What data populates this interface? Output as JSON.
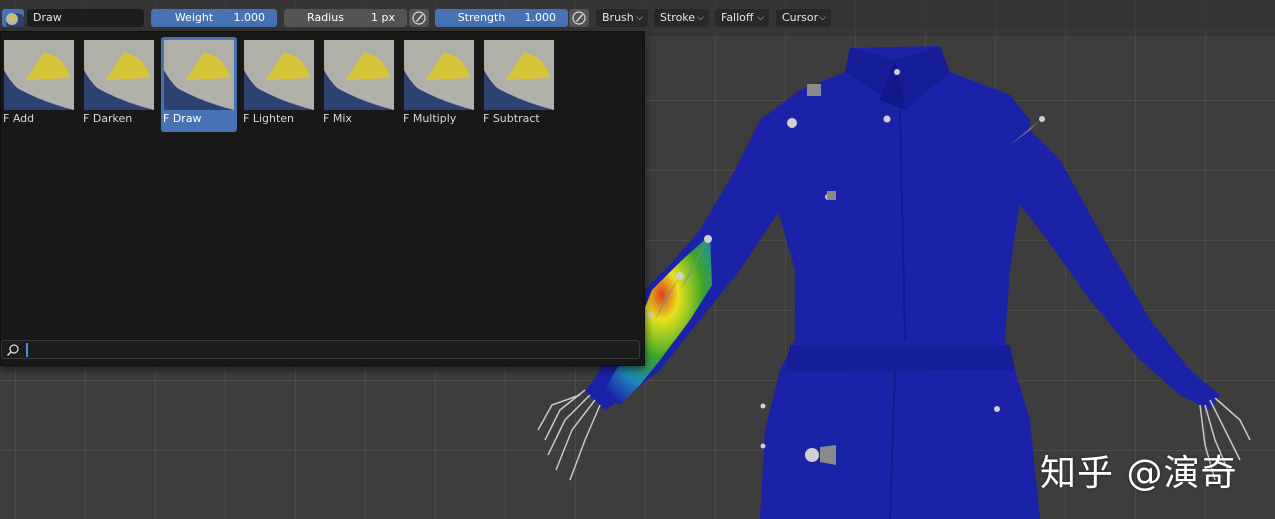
{
  "header": {
    "brush_name": "Draw",
    "weight": {
      "label": "Weight",
      "value": "1.000"
    },
    "radius": {
      "label": "Radius",
      "value": "1 px"
    },
    "strength": {
      "label": "Strength",
      "value": "1.000"
    },
    "menus": [
      {
        "label": "Brush"
      },
      {
        "label": "Stroke"
      },
      {
        "label": "Falloff"
      },
      {
        "label": "Cursor"
      }
    ]
  },
  "brush_presets": [
    {
      "label": "F Add",
      "selected": false
    },
    {
      "label": "F Darken",
      "selected": false
    },
    {
      "label": "F Draw",
      "selected": true
    },
    {
      "label": "F Lighten",
      "selected": false
    },
    {
      "label": "F Mix",
      "selected": false
    },
    {
      "label": "F Multiply",
      "selected": false
    },
    {
      "label": "F Subtract",
      "selected": false
    }
  ],
  "search": {
    "value": "",
    "placeholder": ""
  },
  "watermark": "知乎 @演奇",
  "colors": {
    "accent": "#4772b3",
    "mesh_blue": "#1a22a8",
    "weight_green": "#3aa52c",
    "weight_yellow": "#e8e21e",
    "weight_red": "#e0401c"
  },
  "icons": [
    "brush-thumbnail-icon",
    "pen-pressure-icon",
    "chevron-down-icon",
    "search-icon"
  ]
}
